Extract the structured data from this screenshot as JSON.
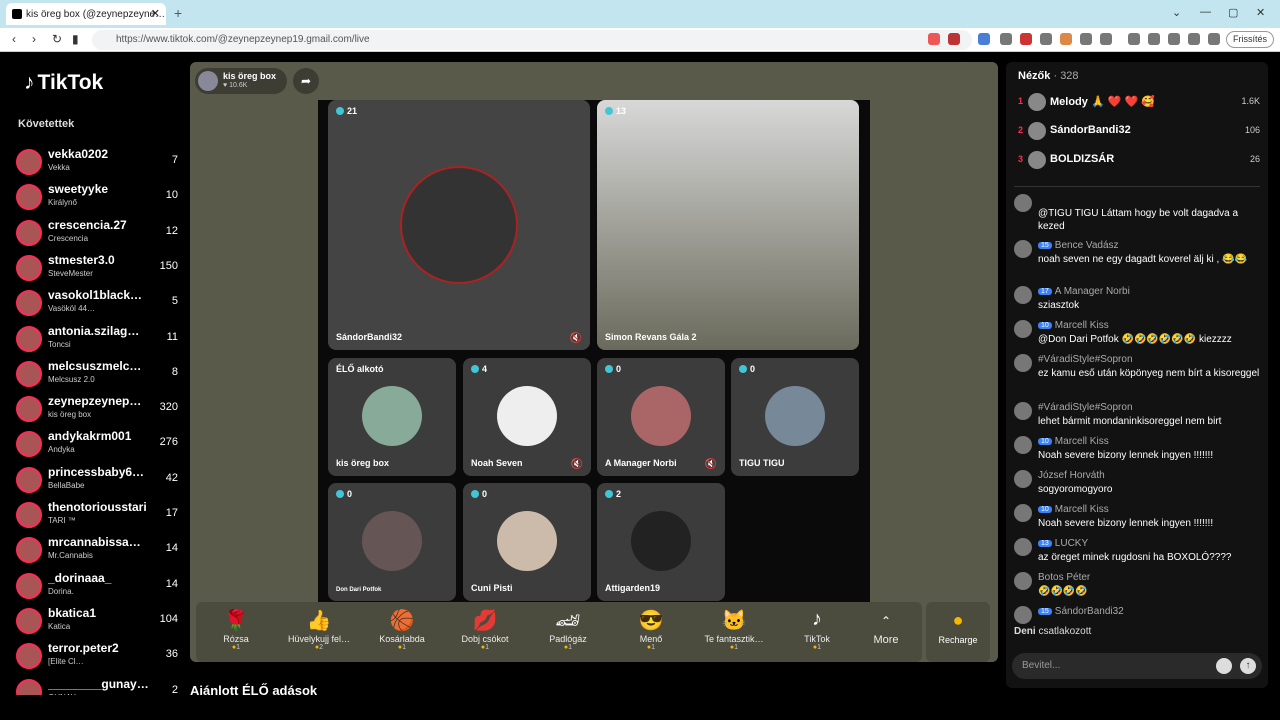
{
  "browser": {
    "tab_title": "kis öreg box (@zeynepzeyne…",
    "url": "https://www.tiktok.com/@zeynepzeynep19.gmail.com/live",
    "refresh_label": "Frissítés"
  },
  "sidebar": {
    "logo": "TikTok",
    "following_label": "Követettek",
    "items": [
      {
        "name": "vekka0202",
        "sub": "Vekka",
        "count": "7"
      },
      {
        "name": "sweetyyke",
        "sub": "Királynő",
        "count": "10"
      },
      {
        "name": "crescencia.27",
        "sub": "Crescencia",
        "count": "12"
      },
      {
        "name": "stmester3.0",
        "sub": "SteveMester",
        "count": "150"
      },
      {
        "name": "vasokol1black…",
        "sub": "Vasököl 44…",
        "count": "5"
      },
      {
        "name": "antonia.szilag…",
        "sub": "Toncsi",
        "count": "11"
      },
      {
        "name": "melcsuszmelc…",
        "sub": "Melcsusz 2.0",
        "count": "8"
      },
      {
        "name": "zeynepzeynep…",
        "sub": "kis öreg box",
        "count": "320"
      },
      {
        "name": "andykakrm001",
        "sub": "Andyka",
        "count": "276"
      },
      {
        "name": "princessbaby6…",
        "sub": "BellaBabe",
        "count": "42"
      },
      {
        "name": "thenotoriousstari",
        "sub": "TARI ™",
        "count": "17"
      },
      {
        "name": "mrcannabissa…",
        "sub": "Mr.Cannabis",
        "count": "14"
      },
      {
        "name": "_dorinaaa_",
        "sub": "Dorina.",
        "count": "14"
      },
      {
        "name": "bkatica1",
        "sub": "Katica",
        "count": "104"
      },
      {
        "name": "terror.peter2",
        "sub": "[Elite Cl…",
        "count": "36"
      },
      {
        "name": "________gunay…",
        "sub": "GUNAY",
        "count": "2"
      }
    ]
  },
  "live": {
    "host_name": "kis öreg box",
    "host_likes": "10.6K",
    "guests": [
      {
        "label": "SándorBandi32",
        "count": "21"
      },
      {
        "label": "Simon Revans Gála 2",
        "count": "13"
      },
      {
        "label": "kis öreg box",
        "count": "ÉLŐ alkotó"
      },
      {
        "label": "Noah Seven",
        "count": "4"
      },
      {
        "label": "A Manager Norbi",
        "count": "0"
      },
      {
        "label": "TIGU TIGU",
        "count": "0"
      },
      {
        "label": "Don Dari Potfok",
        "count": "0"
      },
      {
        "label": "Cuni Pisti",
        "count": "0"
      },
      {
        "label": "Attigarden19",
        "count": "2"
      }
    ]
  },
  "gifts": [
    {
      "name": "Rózsa",
      "price": "1",
      "icon": "🌹"
    },
    {
      "name": "Hüvelykujj fel…",
      "price": "2",
      "icon": "👍"
    },
    {
      "name": "Kosárlabda",
      "price": "1",
      "icon": "🏀"
    },
    {
      "name": "Dobj csókot",
      "price": "1",
      "icon": "💋"
    },
    {
      "name": "Padlógáz",
      "price": "1",
      "icon": "🏎"
    },
    {
      "name": "Menő",
      "price": "1",
      "icon": "😎"
    },
    {
      "name": "Te fantasztik…",
      "price": "1",
      "icon": "🐱"
    },
    {
      "name": "TikTok",
      "price": "1",
      "icon": "♪"
    }
  ],
  "more_label": "More",
  "recharge_label": "Recharge",
  "recommended_label": "Ajánlott ÉLŐ adások",
  "viewers": {
    "title": "Nézők",
    "count": "· 328",
    "top": [
      {
        "rank": "1",
        "name": "Melody 🙏 ❤️ ❤️ 🥰",
        "count": "1.6K"
      },
      {
        "rank": "2",
        "name": "SándorBandi32",
        "count": "106"
      },
      {
        "rank": "3",
        "name": "BOLDIZSÁR",
        "count": "26"
      }
    ]
  },
  "comments": [
    {
      "user": "",
      "badge": "",
      "text": "@TIGU TIGU Láttam hogy be volt dagadva a kezed"
    },
    {
      "user": "Bence Vadász",
      "badge": "15",
      "text": "noah seven ne egy dagadt koverel älj ki , 😂😂"
    },
    {
      "user": "A Manager Norbi",
      "badge": "17",
      "text": "sziasztok"
    },
    {
      "user": "Marcell Kiss",
      "badge": "10",
      "text": "@Don Dari Potfok 🤣🤣🤣🤣🤣🤣 kiezzzz"
    },
    {
      "user": "#VáradiStyle#Sopron",
      "badge": "",
      "text": "ez kamu eső után köpönyeg nem bírt a kisoreggel"
    },
    {
      "user": "#VáradiStyle#Sopron",
      "badge": "",
      "text": "lehet bármit mondaninkisoreggel nem birt"
    },
    {
      "user": "Marcell Kiss",
      "badge": "10",
      "text": "Noah severe bizony lennek ingyen !!!!!!!"
    },
    {
      "user": "József Horváth",
      "badge": "",
      "text": "sogyoromogyoro"
    },
    {
      "user": "Marcell Kiss",
      "badge": "10",
      "text": "Noah severe bizony lennek ingyen !!!!!!!"
    },
    {
      "user": "LUCKY",
      "badge": "13",
      "text": "az öreget minek rugdosni ha BOXOLÓ????"
    },
    {
      "user": "Botos Péter",
      "badge": "",
      "text": "🤣🤣🤣🤣"
    },
    {
      "user": "SándorBandi32",
      "badge": "15",
      "text": ""
    }
  ],
  "joined": {
    "name": "Deni",
    "text": "csatlakozott"
  },
  "input_placeholder": "Bevitel..."
}
